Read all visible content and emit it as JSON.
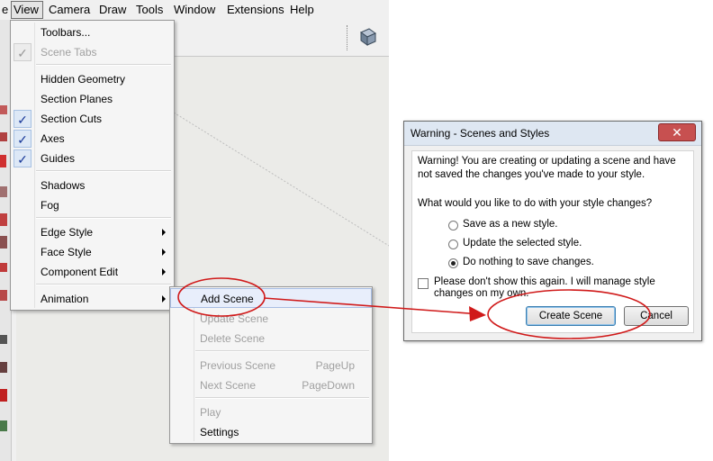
{
  "menubar": {
    "items": [
      {
        "label": "e"
      },
      {
        "label": "View"
      },
      {
        "label": "Camera"
      },
      {
        "label": "Draw"
      },
      {
        "label": "Tools"
      },
      {
        "label": "Window"
      },
      {
        "label": "Extensions"
      },
      {
        "label": "Help"
      }
    ],
    "active": "View"
  },
  "view_menu": {
    "items": [
      {
        "label": "Toolbars...",
        "checked": false,
        "disabled": false,
        "submenu": false
      },
      {
        "label": "Scene Tabs",
        "checked": true,
        "disabled": true,
        "submenu": false
      },
      {
        "label": "Hidden Geometry",
        "checked": false,
        "disabled": false,
        "submenu": false
      },
      {
        "label": "Section Planes",
        "checked": false,
        "disabled": false,
        "submenu": false
      },
      {
        "label": "Section Cuts",
        "checked": true,
        "disabled": false,
        "submenu": false
      },
      {
        "label": "Axes",
        "checked": true,
        "disabled": false,
        "submenu": false
      },
      {
        "label": "Guides",
        "checked": true,
        "disabled": false,
        "submenu": false
      },
      {
        "label": "Shadows",
        "checked": false,
        "disabled": false,
        "submenu": false
      },
      {
        "label": "Fog",
        "checked": false,
        "disabled": false,
        "submenu": false
      },
      {
        "label": "Edge Style",
        "checked": false,
        "disabled": false,
        "submenu": true
      },
      {
        "label": "Face Style",
        "checked": false,
        "disabled": false,
        "submenu": true
      },
      {
        "label": "Component Edit",
        "checked": false,
        "disabled": false,
        "submenu": true
      },
      {
        "label": "Animation",
        "checked": false,
        "disabled": false,
        "submenu": true
      }
    ],
    "check_glyph": "✓"
  },
  "animation_submenu": {
    "items": [
      {
        "label": "Add Scene",
        "shortcut": "",
        "disabled": false
      },
      {
        "label": "Update Scene",
        "shortcut": "",
        "disabled": true
      },
      {
        "label": "Delete Scene",
        "shortcut": "",
        "disabled": true
      },
      {
        "label": "Previous Scene",
        "shortcut": "PageUp",
        "disabled": true
      },
      {
        "label": "Next Scene",
        "shortcut": "PageDown",
        "disabled": true
      },
      {
        "label": "Play",
        "shortcut": "",
        "disabled": true
      },
      {
        "label": "Settings",
        "shortcut": "",
        "disabled": false
      }
    ]
  },
  "dialog": {
    "title": "Warning - Scenes and Styles",
    "close_glyph": "✕",
    "message": "Warning! You are creating or updating a scene and have not saved the changes you've made to your style.",
    "question": "What would you like to do with your style changes?",
    "options": [
      {
        "label": "Save as a new style.",
        "selected": false
      },
      {
        "label": "Update the selected style.",
        "selected": false
      },
      {
        "label": "Do nothing to save changes.",
        "selected": true
      }
    ],
    "checkbox_label": "Please don't show this again.  I will manage style changes on my own.",
    "checkbox_checked": false,
    "create_button": "Create Scene",
    "cancel_button": "Cancel"
  },
  "toolbar": {
    "icon": "cube-view-icon"
  },
  "colors": {
    "annotation": "#d01a1a",
    "check": "#1a3a9a",
    "close_button": "#c75050"
  }
}
